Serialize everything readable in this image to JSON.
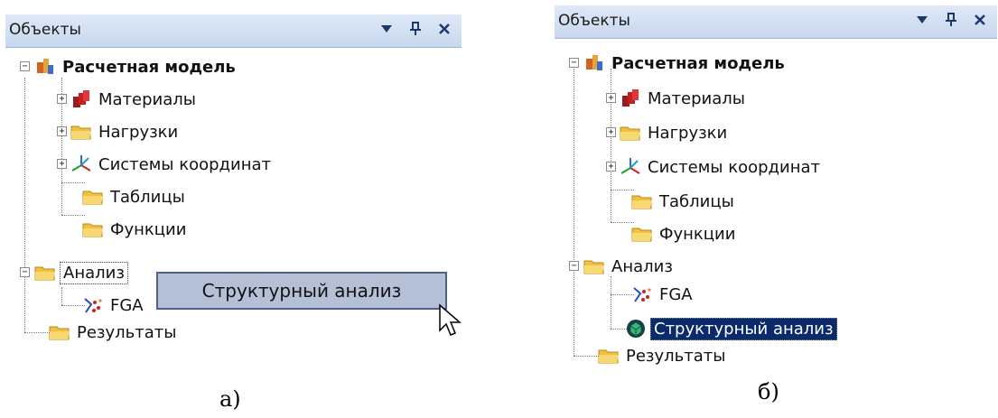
{
  "panel_a": {
    "title": "Объекты",
    "tree": {
      "root": "Расчетная модель",
      "children": [
        "Материалы",
        "Нагрузки",
        "Системы координат",
        "Таблицы",
        "Функции"
      ],
      "analysis": "Анализ",
      "analysis_child": "FGA",
      "results": "Результаты"
    },
    "drag_item": "Структурный анализ"
  },
  "panel_b": {
    "title": "Объекты",
    "tree": {
      "root": "Расчетная модель",
      "children": [
        "Материалы",
        "Нагрузки",
        "Системы координат",
        "Таблицы",
        "Функции"
      ],
      "analysis": "Анализ",
      "analysis_children": [
        "FGA",
        "Структурный анализ"
      ],
      "results": "Результаты"
    }
  },
  "captions": [
    "а)",
    "б)"
  ],
  "icons": {
    "titlebar": [
      "chevron-down-icon",
      "pin-icon",
      "close-icon"
    ],
    "root": "model-icon",
    "materials": "materials-icon",
    "folder": "folder-icon",
    "axes": "coordinate-axes-icon",
    "fga": "fga-analysis-icon",
    "structural": "structural-analysis-icon",
    "cursor": "mouse-pointer-icon"
  }
}
